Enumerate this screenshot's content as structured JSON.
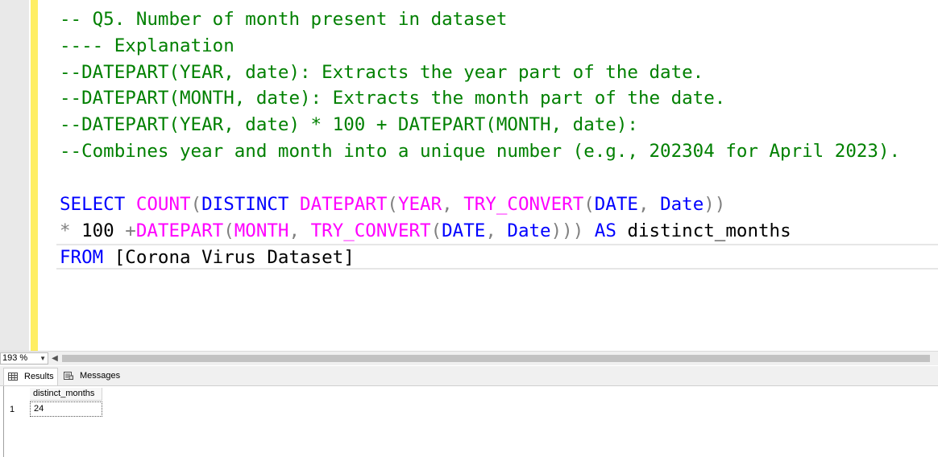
{
  "editor": {
    "lines": {
      "l1": "-- Q5. Number of month present in dataset",
      "l2": "---- Explanation",
      "l3": "--DATEPART(YEAR, date): Extracts the year part of the date.",
      "l4": "--DATEPART(MONTH, date): Extracts the month part of the date.",
      "l5": "--DATEPART(YEAR, date) * 100 + DATEPART(MONTH, date):",
      "l6": "--Combines year and month into a unique number (e.g., 202304 for April 2023).",
      "sql1": {
        "select": "SELECT",
        "count": "COUNT",
        "p1": "(",
        "distinct": "DISTINCT",
        "datepart": "DATEPART",
        "p2": "(",
        "year": "YEAR",
        "comma1": ", ",
        "try_convert": "TRY_CONVERT",
        "p3": "(",
        "date_type": "DATE",
        "comma2": ", ",
        "date_col": "Date",
        "close": "))"
      },
      "sql2": {
        "star": "*",
        "hundred": "100",
        "plus": "+",
        "datepart": "DATEPART",
        "p1": "(",
        "month": "MONTH",
        "comma1": ", ",
        "try_convert": "TRY_CONVERT",
        "p2": "(",
        "date_type": "DATE",
        "comma2": ", ",
        "date_col": "Date",
        "close": ")))",
        "as": "AS",
        "alias": "distinct_months"
      },
      "sql3": {
        "from": "FROM",
        "table": "[Corona Virus Dataset]"
      }
    }
  },
  "zoom": {
    "value": "193 %"
  },
  "tabs": {
    "results": "Results",
    "messages": "Messages"
  },
  "grid": {
    "column": "distinct_months",
    "rows": [
      {
        "num": "1",
        "value": "24"
      }
    ]
  },
  "colors": {
    "comment": "#008000",
    "keyword": "#0000ff",
    "function": "#ff00ff",
    "operator": "#808080",
    "change_bar": "#ffee62"
  },
  "icons": {
    "results_tab": "grid-icon",
    "messages_tab": "messages-icon",
    "zoom_dropdown": "chevron-down-icon",
    "scroll_left": "arrow-left-icon"
  }
}
